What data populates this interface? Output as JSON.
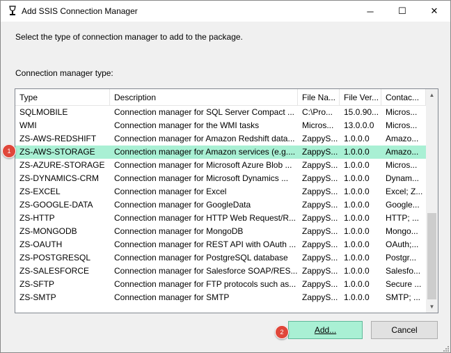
{
  "window": {
    "title": "Add SSIS Connection Manager",
    "controls": {
      "minimize": "─",
      "maximize": "☐",
      "close": "✕"
    }
  },
  "prompt_text": "Select the type of connection manager to add to the package.",
  "list_label": "Connection manager type:",
  "list": {
    "columns": [
      "Type",
      "Description",
      "File Na...",
      "File Ver...",
      "Contac..."
    ],
    "selected_index": 3,
    "rows": [
      {
        "type": "SQLMOBILE",
        "description": "Connection manager for SQL Server Compact ...",
        "file_name": "C:\\Pro...",
        "file_version": "15.0.90...",
        "contact": "Micros..."
      },
      {
        "type": "WMI",
        "description": "Connection manager for the WMI tasks",
        "file_name": "Micros...",
        "file_version": "13.0.0.0",
        "contact": "Micros..."
      },
      {
        "type": "ZS-AWS-REDSHIFT",
        "description": "Connection manager for Amazon Redshift data...",
        "file_name": "ZappyS...",
        "file_version": "1.0.0.0",
        "contact": "Amazo..."
      },
      {
        "type": "ZS-AWS-STORAGE",
        "description": "Connection manager for Amazon services (e.g....",
        "file_name": "ZappyS...",
        "file_version": "1.0.0.0",
        "contact": "Amazo..."
      },
      {
        "type": "ZS-AZURE-STORAGE",
        "description": "Connection manager for Microsoft Azure Blob ...",
        "file_name": "ZappyS...",
        "file_version": "1.0.0.0",
        "contact": "Micros..."
      },
      {
        "type": "ZS-DYNAMICS-CRM",
        "description": "Connection manager for Microsoft Dynamics ...",
        "file_name": "ZappyS...",
        "file_version": "1.0.0.0",
        "contact": "Dynam..."
      },
      {
        "type": "ZS-EXCEL",
        "description": "Connection manager for Excel",
        "file_name": "ZappyS...",
        "file_version": "1.0.0.0",
        "contact": "Excel; Z..."
      },
      {
        "type": "ZS-GOOGLE-DATA",
        "description": "Connection manager for GoogleData",
        "file_name": "ZappyS...",
        "file_version": "1.0.0.0",
        "contact": "Google..."
      },
      {
        "type": "ZS-HTTP",
        "description": "Connection manager for HTTP Web Request/R...",
        "file_name": "ZappyS...",
        "file_version": "1.0.0.0",
        "contact": "HTTP; ..."
      },
      {
        "type": "ZS-MONGODB",
        "description": "Connection manager for MongoDB",
        "file_name": "ZappyS...",
        "file_version": "1.0.0.0",
        "contact": "Mongo..."
      },
      {
        "type": "ZS-OAUTH",
        "description": "Connection manager for REST API with OAuth ...",
        "file_name": "ZappyS...",
        "file_version": "1.0.0.0",
        "contact": "OAuth;..."
      },
      {
        "type": "ZS-POSTGRESQL",
        "description": "Connection manager for PostgreSQL database",
        "file_name": "ZappyS...",
        "file_version": "1.0.0.0",
        "contact": "Postgr..."
      },
      {
        "type": "ZS-SALESFORCE",
        "description": "Connection manager for Salesforce SOAP/RES...",
        "file_name": "ZappyS...",
        "file_version": "1.0.0.0",
        "contact": "Salesfo..."
      },
      {
        "type": "ZS-SFTP",
        "description": "Connection manager for FTP protocols such as...",
        "file_name": "ZappyS...",
        "file_version": "1.0.0.0",
        "contact": "Secure ..."
      },
      {
        "type": "ZS-SMTP",
        "description": "Connection manager for SMTP",
        "file_name": "ZappyS...",
        "file_version": "1.0.0.0",
        "contact": "SMTP; ..."
      }
    ]
  },
  "buttons": {
    "add": "Add...",
    "cancel": "Cancel"
  },
  "annotations": {
    "step1": "1",
    "step2": "2"
  },
  "icons": {
    "app": "ssis-package-icon",
    "scroll_up": "chevron-up-icon",
    "scroll_down": "chevron-down-icon"
  },
  "colors": {
    "selection": "#a9f0d4",
    "badge": "#e0473a"
  }
}
